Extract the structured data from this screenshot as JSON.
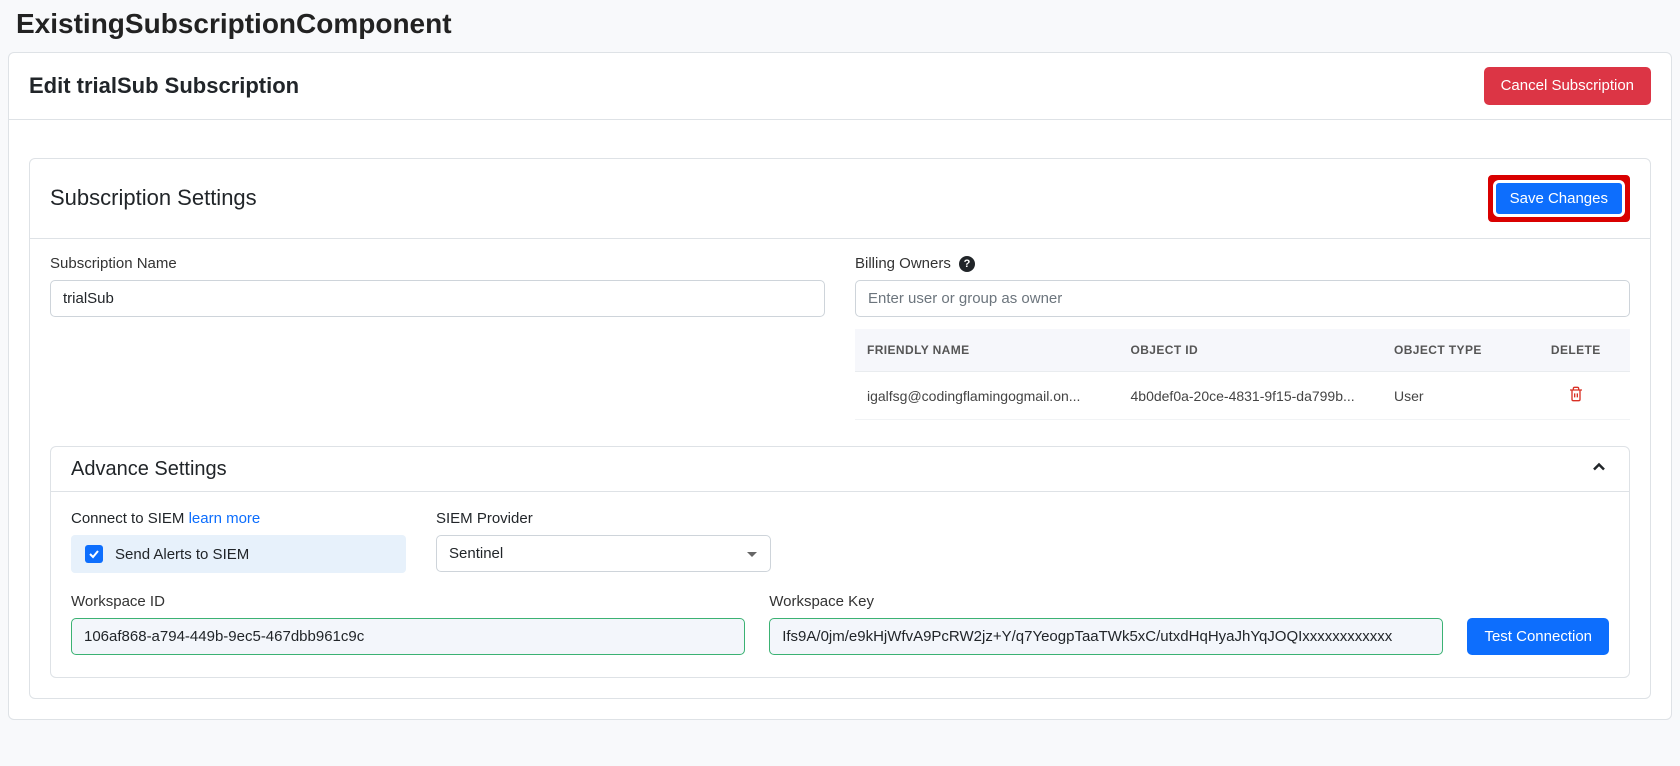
{
  "component_heading": "ExistingSubscriptionComponent",
  "header": {
    "title": "Edit trialSub Subscription",
    "cancel_label": "Cancel Subscription"
  },
  "settings": {
    "title": "Subscription Settings",
    "save_label": "Save Changes",
    "sub_name_label": "Subscription Name",
    "sub_name_value": "trialSub",
    "billing_owners_label": "Billing Owners",
    "billing_owners_placeholder": "Enter user or group as owner",
    "owners_columns": {
      "name": "FRIENDLY NAME",
      "id": "OBJECT ID",
      "type": "OBJECT TYPE",
      "delete": "DELETE"
    },
    "owners": [
      {
        "name": "igalfsg@codingflamingogmail.on...",
        "id": "4b0def0a-20ce-4831-9f15-da799b...",
        "type": "User"
      }
    ]
  },
  "advance": {
    "title": "Advance Settings",
    "connect_label": "Connect to SIEM ",
    "learn_more": "learn more",
    "send_alerts_label": "Send Alerts to SIEM",
    "provider_label": "SIEM Provider",
    "provider_value": "Sentinel",
    "workspace_id_label": "Workspace ID",
    "workspace_id_value": "106af868-a794-449b-9ec5-467dbb961c9c",
    "workspace_key_label": "Workspace Key",
    "workspace_key_value": "Ifs9A/0jm/e9kHjWfvA9PcRW2jz+Y/q7YeogpTaaTWk5xC/utxdHqHyaJhYqJOQIxxxxxxxxxxxx",
    "test_label": "Test Connection"
  }
}
